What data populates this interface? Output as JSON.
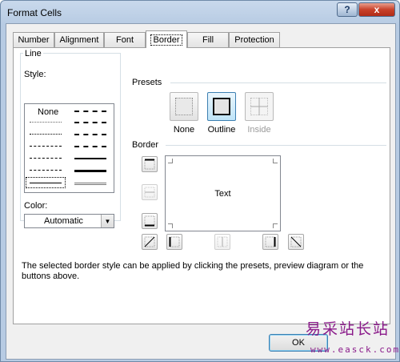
{
  "window": {
    "title": "Format Cells",
    "help_label": "?",
    "close_label": "x"
  },
  "tabs": [
    {
      "label": "Number",
      "active": false
    },
    {
      "label": "Alignment",
      "active": false
    },
    {
      "label": "Font",
      "active": false
    },
    {
      "label": "Border",
      "active": true
    },
    {
      "label": "Fill",
      "active": false
    },
    {
      "label": "Protection",
      "active": false
    }
  ],
  "line": {
    "group_label": "Line",
    "style_label": "Style:",
    "none_label": "None",
    "color_label": "Color:",
    "color_value": "Automatic"
  },
  "presets": {
    "group_label": "Presets",
    "items": [
      {
        "label": "None",
        "enabled": true
      },
      {
        "label": "Outline",
        "enabled": true
      },
      {
        "label": "Inside",
        "enabled": false
      }
    ]
  },
  "border": {
    "group_label": "Border",
    "preview_text": "Text"
  },
  "hint": "The selected border style can be applied by clicking the presets, preview diagram or the buttons above.",
  "footer": {
    "ok_label": "OK"
  },
  "watermark": {
    "chinese": "易采站长站",
    "url": "www.easck.com"
  },
  "colors": {
    "accent": "#3c7fb1",
    "close": "#c8412a",
    "watermark": "#8a1a8a"
  }
}
